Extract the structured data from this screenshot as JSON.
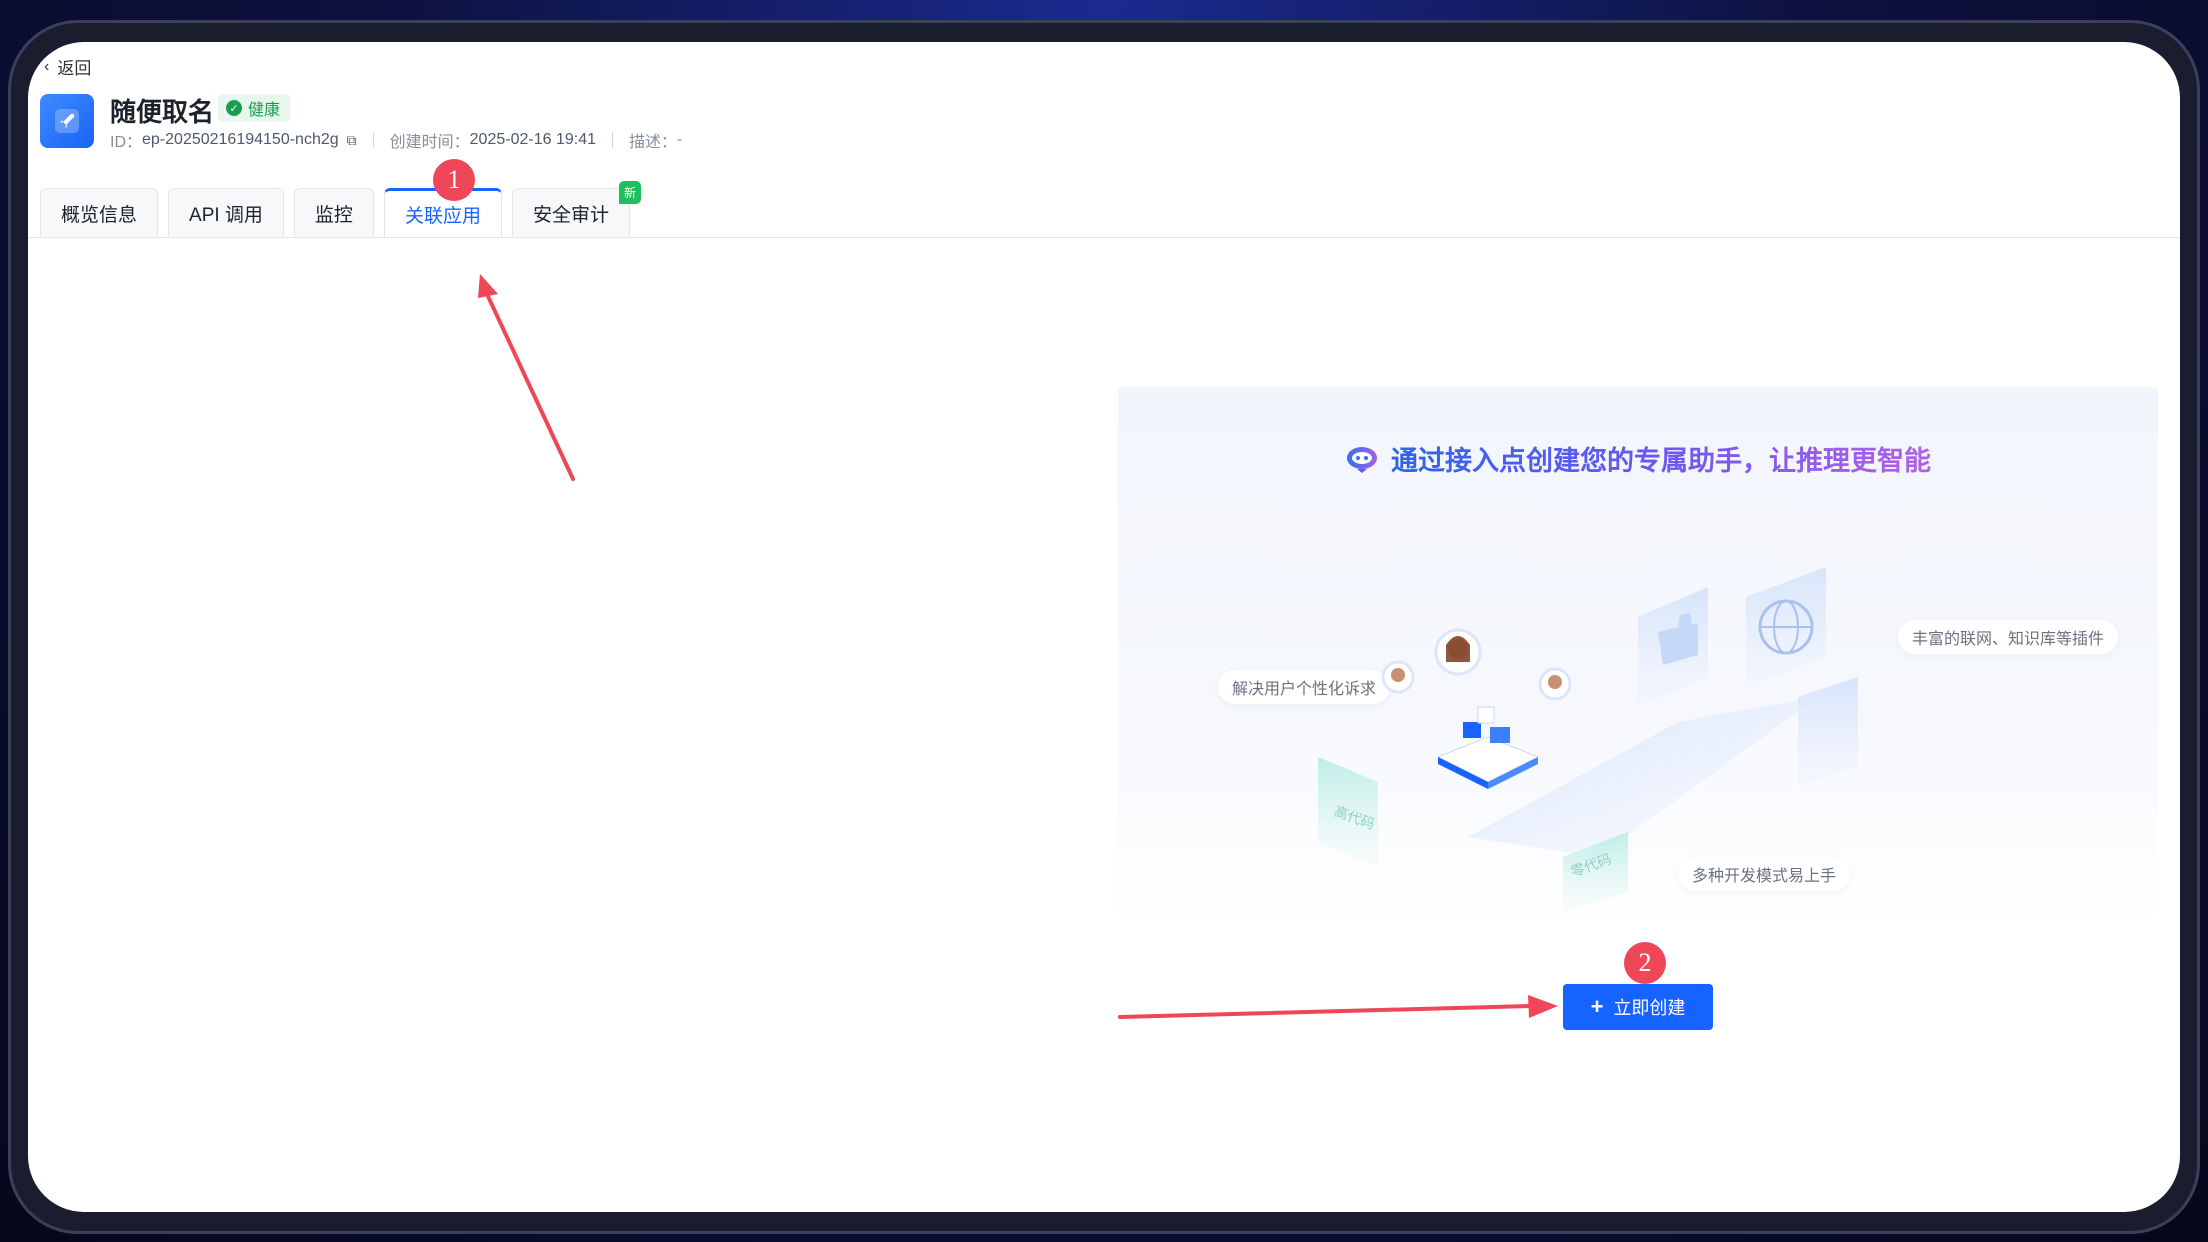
{
  "back": {
    "label": "返回"
  },
  "endpoint": {
    "name": "随便取名",
    "status": "健康",
    "id_label": "ID：",
    "id": "ep-20250216194150-nch2g",
    "created_label": "创建时间：",
    "created": "2025-02-16 19:41",
    "desc_label": "描述：",
    "desc": "-"
  },
  "tabs": [
    {
      "label": "概览信息"
    },
    {
      "label": "API 调用"
    },
    {
      "label": "监控"
    },
    {
      "label": "关联应用"
    },
    {
      "label": "安全审计",
      "tag": "新"
    }
  ],
  "annotations": {
    "step1": "1",
    "step2": "2",
    "color": "#ef4757"
  },
  "promo": {
    "title": "通过接入点创建您的专属助手，让推理更智能",
    "features": [
      "解决用户个性化诉求",
      "丰富的联网、知识库等插件",
      "多种开发模式易上手"
    ],
    "card_labels": [
      "高代码",
      "零代码"
    ]
  },
  "create_button": {
    "label": "立即创建"
  },
  "colors": {
    "accent": "#1664ff",
    "health": "#1a9d4e",
    "new_tag": "#1fbf5f"
  }
}
